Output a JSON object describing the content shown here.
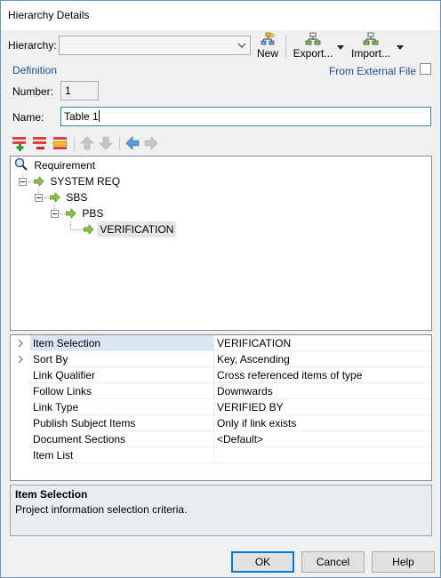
{
  "window": {
    "title": "Hierarchy Details"
  },
  "toolbar": {
    "hierarchy_label": "Hierarchy:",
    "hierarchy_value": "",
    "new_label": "New",
    "export_label": "Export...",
    "import_label": "Import..."
  },
  "definition": {
    "group_label": "Definition",
    "from_external_label": "From External File",
    "from_external_checked": false,
    "number_label": "Number:",
    "number_value": "1",
    "name_label": "Name:",
    "name_value": "Table 1"
  },
  "tree": {
    "root": "Requirement",
    "nodes": [
      "SYSTEM REQ",
      "SBS",
      "PBS",
      "VERIFICATION"
    ],
    "selected": "VERIFICATION"
  },
  "grid": {
    "rows": [
      {
        "name": "Item Selection",
        "value": "VERIFICATION",
        "expandable": true,
        "selected": true
      },
      {
        "name": "Sort By",
        "value": "Key, Ascending",
        "expandable": true,
        "selected": false
      },
      {
        "name": "Link Qualifier",
        "value": "Cross referenced items of type",
        "expandable": false,
        "selected": false
      },
      {
        "name": "Follow Links",
        "value": "Downwards",
        "expandable": false,
        "selected": false
      },
      {
        "name": "Link Type",
        "value": "VERIFIED BY",
        "expandable": false,
        "selected": false
      },
      {
        "name": "Publish Subject Items",
        "value": "Only if link exists",
        "expandable": false,
        "selected": false
      },
      {
        "name": "Document Sections",
        "value": "<Default>",
        "expandable": false,
        "selected": false
      },
      {
        "name": "Item List",
        "value": "",
        "expandable": false,
        "selected": false
      }
    ]
  },
  "description": {
    "title": "Item Selection",
    "text": "Project information selection criteria."
  },
  "footer": {
    "ok_label": "OK",
    "cancel_label": "Cancel",
    "help_label": "Help"
  },
  "icons": {
    "add": "add-row-icon",
    "remove": "remove-row-icon",
    "insert": "insert-row-icon",
    "up": "move-up-icon",
    "down": "move-down-icon",
    "left": "move-left-icon",
    "right": "move-right-icon"
  },
  "colors": {
    "accent": "#0078d7",
    "group_label": "#1f4b99",
    "selected_row": "#dbe5f3"
  }
}
